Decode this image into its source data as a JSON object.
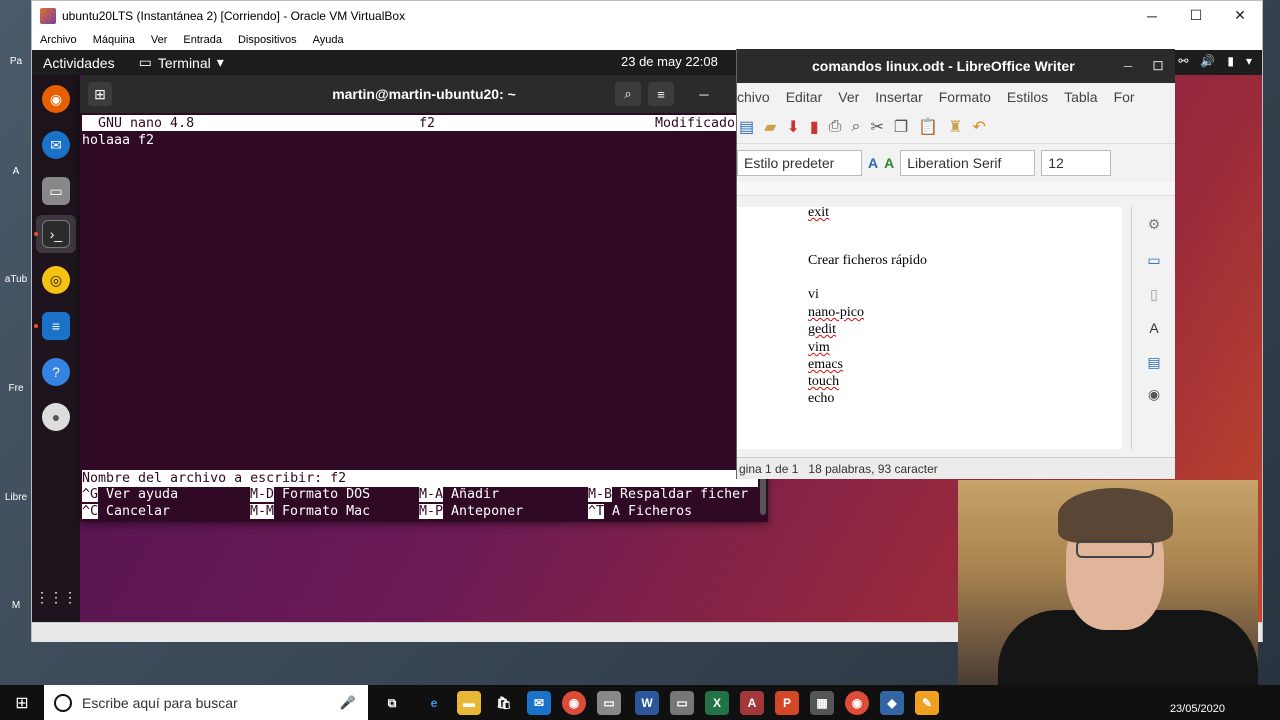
{
  "host": {
    "desktop_icons": [
      "Pa",
      "A",
      "aTub",
      "Fre",
      "Libre",
      "M"
    ],
    "vbox_title": "ubuntu20LTS (Instantánea 2) [Corriendo] - Oracle VM VirtualBox",
    "menu": [
      "Archivo",
      "Máquina",
      "Ver",
      "Entrada",
      "Dispositivos",
      "Ayuda"
    ],
    "window_buttons": {
      "minimize": "─",
      "maximize": "☐",
      "close": "✕"
    }
  },
  "ubuntu": {
    "activities": "Actividades",
    "app_menu": "Terminal",
    "clock": "23 de may  22:08"
  },
  "terminal": {
    "title": "martin@martin-ubuntu20: ~",
    "nano": {
      "version": "  GNU nano 4.8",
      "filename": "f2",
      "status": "Modificado",
      "content_line": "holaaa f2",
      "prompt": "Nombre del archivo a escribir: f2",
      "help_row1": [
        {
          "key": "^G",
          "label": " Ver ayuda"
        },
        {
          "key": "M-D",
          "label": " Formato DOS"
        },
        {
          "key": "M-A",
          "label": " Añadir"
        },
        {
          "key": "M-B",
          "label": " Respaldar ficher"
        }
      ],
      "help_row2": [
        {
          "key": "^C",
          "label": " Cancelar"
        },
        {
          "key": "M-M",
          "label": " Formato Mac"
        },
        {
          "key": "M-P",
          "label": " Anteponer"
        },
        {
          "key": "^T",
          "label": " A Ficheros"
        }
      ]
    }
  },
  "writer": {
    "title": "comandos linux.odt - LibreOffice Writer",
    "menu": [
      "chivo",
      "Editar",
      "Ver",
      "Insertar",
      "Formato",
      "Estilos",
      "Tabla",
      "For"
    ],
    "paragraph_style": "Estilo predeter",
    "font_name": "Liberation Serif",
    "font_size": "12",
    "doc_lines": {
      "partial": "exit",
      "heading": "Crear ficheros rápido",
      "items": [
        "vi",
        "nano-pico",
        "gedit",
        "vim",
        "emacs",
        "touch",
        "echo"
      ]
    },
    "status_page": "gina 1 de 1",
    "status_words": "18 palabras, 93 caracter"
  },
  "taskbar": {
    "search_placeholder": "Escribe aquí para buscar",
    "date": "23/05/2020",
    "apps": [
      "W",
      "X",
      "A",
      "P"
    ]
  }
}
